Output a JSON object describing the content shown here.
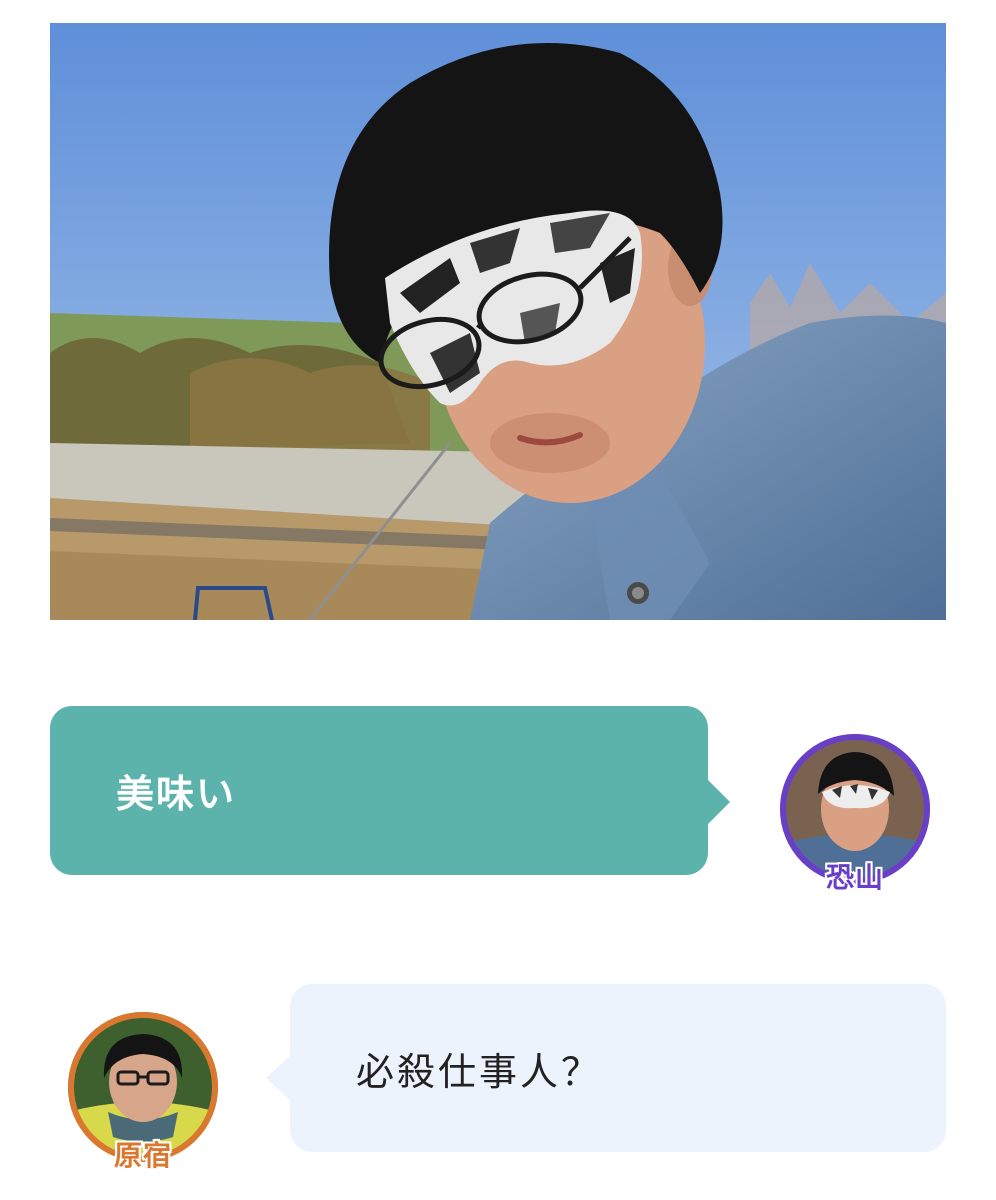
{
  "colors": {
    "bubble_right_bg": "#5bb3ab",
    "bubble_left_bg": "#edf3fc",
    "avatar_right_ring": "#6a3fc8",
    "avatar_left_ring": "#d9782e"
  },
  "photo": {
    "icon": "photo-man-with-mask"
  },
  "messages": [
    {
      "side": "right",
      "text": "美味い",
      "speaker": "恐山"
    },
    {
      "side": "left",
      "text": "必殺仕事人？",
      "speaker": "原宿"
    }
  ]
}
